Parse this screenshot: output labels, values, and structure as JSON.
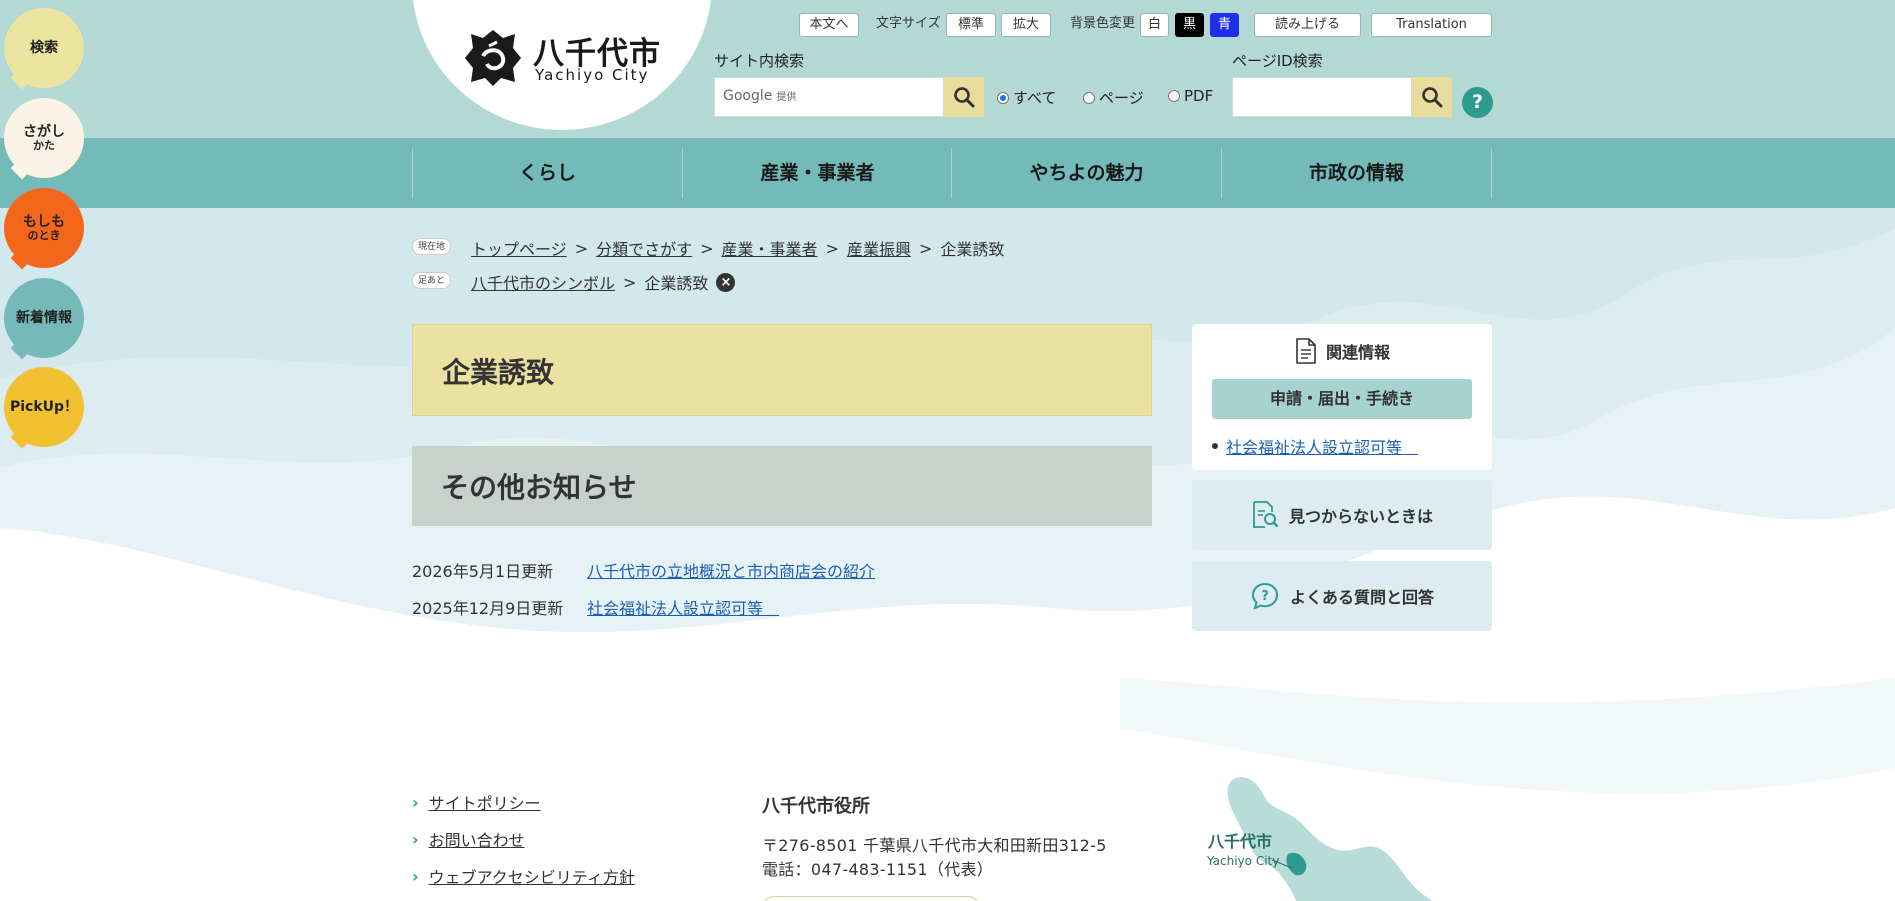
{
  "side_bubbles": [
    {
      "line1": "検索",
      "line2": "",
      "bg": "#ede4a2",
      "fg": "#222"
    },
    {
      "line1": "さがし",
      "line2": "かた",
      "bg": "#fbf4e6",
      "fg": "#222"
    },
    {
      "line1": "もしも",
      "line2": "のとき",
      "bg": "#f4661b",
      "fg": "#222"
    },
    {
      "line1": "新着情報",
      "line2": "",
      "bg": "#75bab8",
      "fg": "#222"
    },
    {
      "line1": "PickUp！",
      "line2": "",
      "bg": "#f2c131",
      "fg": "#222"
    }
  ],
  "logo": {
    "title": "八千代市",
    "subtitle": "Yachiyo City"
  },
  "utility": {
    "skip_label": "本文へ",
    "font_size_label": "文字サイズ",
    "font_standard": "標準",
    "font_large": "拡大",
    "bg_color_label": "背景色変更",
    "bg_white": "白",
    "bg_black": "黒",
    "bg_blue": "青",
    "read_aloud": "読み上げる",
    "translation": "Translation"
  },
  "site_search": {
    "label": "サイト内検索",
    "google": "Google",
    "google_sub": "提供",
    "options": [
      "すべて",
      "ページ",
      "PDF"
    ],
    "selected": "すべて"
  },
  "page_id_search": {
    "label": "ページID検索"
  },
  "help": {
    "label": "?"
  },
  "nav": {
    "items": [
      "くらし",
      "産業・事業者",
      "やちよの魅力",
      "市政の情報"
    ]
  },
  "breadcrumb": {
    "current_tag": "現在地",
    "items": [
      "トップページ",
      "分類でさがす",
      "産業・事業者",
      "産業振興"
    ],
    "current": "企業誘致",
    "history_tag": "足あと",
    "history_items": [
      "八千代市のシンボル"
    ],
    "history_current": "企業誘致",
    "separator": ">",
    "close": "×"
  },
  "page_title": "企業誘致",
  "section_title": "その他お知らせ",
  "news": [
    {
      "date": "2026年5月1日更新",
      "title": "八千代市の立地概況と市内商店会の紹介"
    },
    {
      "date": "2025年12月9日更新",
      "title": "社会福祉法人設立認可等　"
    }
  ],
  "related": {
    "heading": "関連情報",
    "category": "申請・届出・手続き",
    "links": [
      "社会福祉法人設立認可等　"
    ]
  },
  "side_buttons": {
    "not_found": "見つからないときは",
    "faq": "よくある質問と回答"
  },
  "footer": {
    "links": [
      "サイトポリシー",
      "お問い合わせ",
      "ウェブアクセシビリティ方針"
    ],
    "office": "八千代市役所",
    "address": "〒276-8501 千葉県八千代市大和田新田312-5",
    "phone": "電話：047-483-1151（代表）",
    "map_label": "八千代市",
    "map_label_en": "Yachiyo City"
  },
  "colors": {
    "header_bg": "#b4d9d5",
    "nav_bg": "#73bab9",
    "title_bg": "#ebe1a0",
    "accent": "#2f9a8e",
    "link": "#1a5fb4"
  }
}
